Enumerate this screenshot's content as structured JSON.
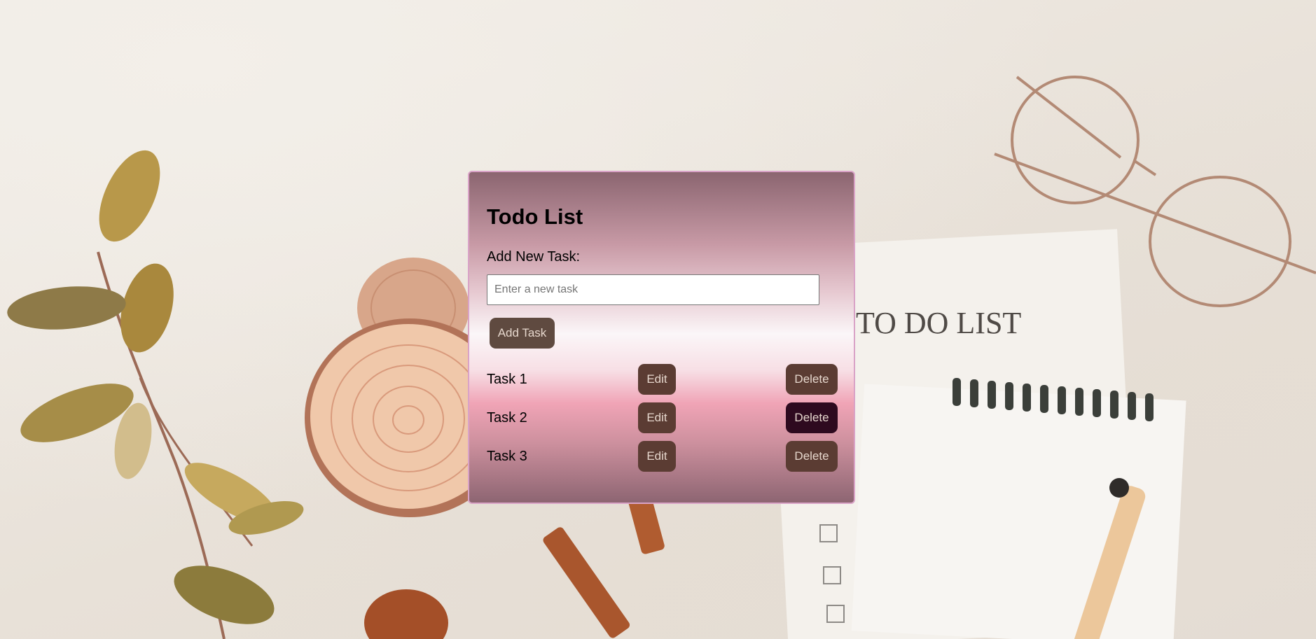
{
  "app": {
    "title": "Todo List",
    "add_label": "Add New Task:",
    "input": {
      "placeholder": "Enter a new task",
      "value": ""
    },
    "add_button": "Add Task"
  },
  "tasks": [
    {
      "label": "Task 1",
      "edit": "Edit",
      "delete": "Delete"
    },
    {
      "label": "Task 2",
      "edit": "Edit",
      "delete": "Delete"
    },
    {
      "label": "Task 3",
      "edit": "Edit",
      "delete": "Delete"
    }
  ],
  "background": {
    "notebook_heading": "TO DO LIST"
  },
  "colors": {
    "card_border": "#d9a3c7",
    "button": "#5f4a40",
    "button_text": "#e6d7cd",
    "delete_active": "#2e0a1f"
  }
}
